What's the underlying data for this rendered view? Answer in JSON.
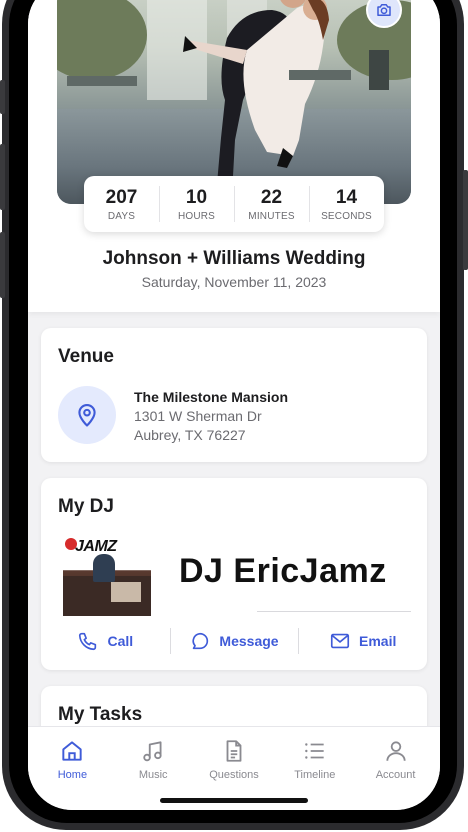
{
  "countdown": {
    "days": "207",
    "days_label": "DAYS",
    "hours": "10",
    "hours_label": "HOURS",
    "minutes": "22",
    "minutes_label": "MINUTES",
    "seconds": "14",
    "seconds_label": "SECONDS"
  },
  "event": {
    "title": "Johnson + Williams Wedding",
    "date": "Saturday, November 11, 2023"
  },
  "venue": {
    "heading": "Venue",
    "name": "The Milestone Mansion",
    "address_line1": "1301 W Sherman Dr",
    "address_line2": "Aubrey, TX 76227",
    "icon": "location-pin-icon"
  },
  "dj": {
    "heading": "My DJ",
    "name": "DJ EricJamz",
    "logo_text": "JAMZ",
    "actions": {
      "call": "Call",
      "message": "Message",
      "email": "Email"
    }
  },
  "tasks": {
    "heading": "My Tasks"
  },
  "tabs": {
    "home": "Home",
    "music": "Music",
    "questions": "Questions",
    "timeline": "Timeline",
    "account": "Account"
  },
  "colors": {
    "accent": "#3f5bd8",
    "icon_bg": "#e4eafd",
    "text_primary": "#1d1d1f",
    "text_secondary": "#6b6b70"
  }
}
